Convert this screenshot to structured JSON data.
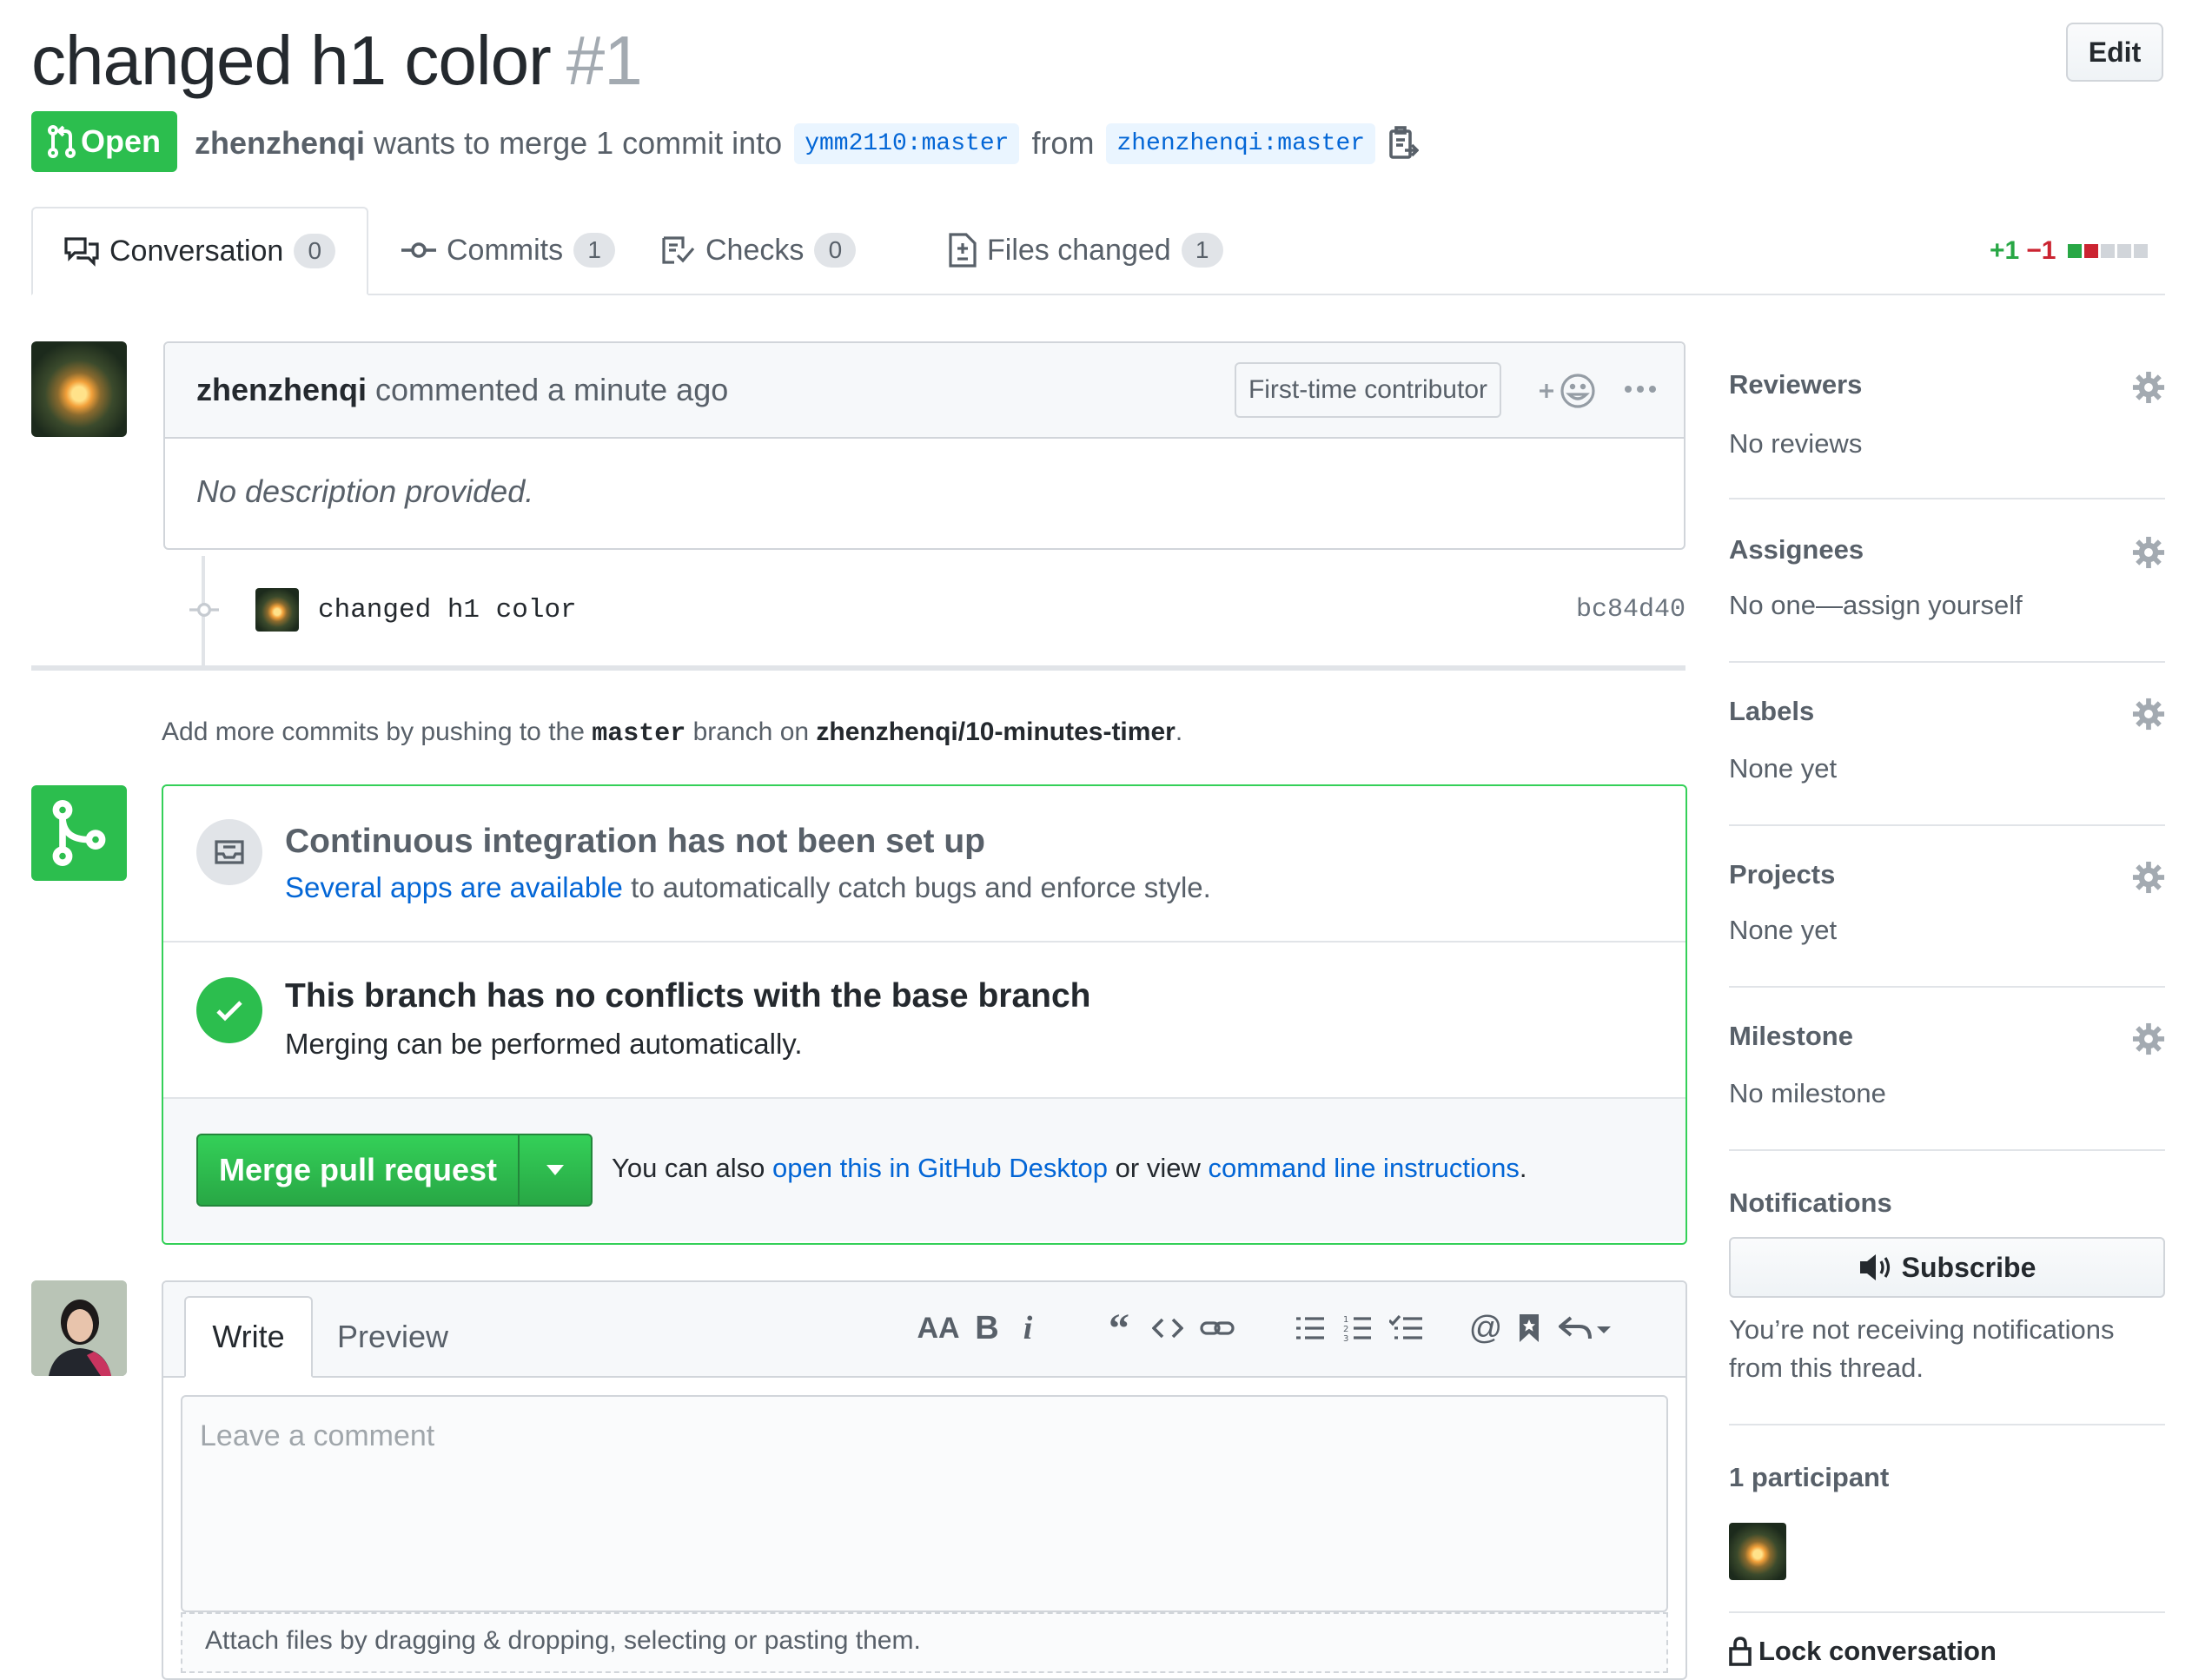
{
  "header": {
    "title": "changed h1 color",
    "number": "#1",
    "edit_label": "Edit",
    "state": "Open",
    "author": "zhenzhenqi",
    "merge_text": "wants to merge 1 commit into",
    "base_branch": "ymm2110:master",
    "from_text": "from",
    "head_branch": "zhenzhenqi:master"
  },
  "tabs": [
    {
      "label": "Conversation",
      "count": "0",
      "icon": "comment-discussion-icon"
    },
    {
      "label": "Commits",
      "count": "1",
      "icon": "git-commit-icon"
    },
    {
      "label": "Checks",
      "count": "0",
      "icon": "checklist-icon"
    },
    {
      "label": "Files changed",
      "count": "1",
      "icon": "file-diff-icon"
    }
  ],
  "diffstat": {
    "additions": "+1",
    "deletions": "−1",
    "colors": {
      "add": "#28a745",
      "del": "#cb2431",
      "neutral": "#d1d5da"
    }
  },
  "comment": {
    "author": "zhenzhenqi",
    "action": "commented a minute ago",
    "badge": "First-time contributor",
    "body": "No description provided."
  },
  "commit": {
    "message": "changed h1 color",
    "sha": "bc84d40"
  },
  "add_more": {
    "prefix": "Add more commits by pushing to the",
    "branch": "master",
    "middle": "branch on",
    "repo": "zhenzhenqi/10-minutes-timer",
    "suffix": "."
  },
  "merge": {
    "ci_title": "Continuous integration has not been set up",
    "ci_link": "Several apps are available",
    "ci_rest": "to automatically catch bugs and enforce style.",
    "conflict_title": "This branch has no conflicts with the base branch",
    "conflict_desc": "Merging can be performed automatically.",
    "button": "Merge pull request",
    "alt_prefix": "You can also",
    "alt_link1": "open this in GitHub Desktop",
    "alt_mid": "or view",
    "alt_link2": "command line instructions",
    "alt_suffix": "."
  },
  "new_comment": {
    "write_tab": "Write",
    "preview_tab": "Preview",
    "placeholder": "Leave a comment",
    "attach": "Attach files by dragging & dropping, selecting or pasting them.",
    "toolbar_icons": [
      "text-size-icon",
      "bold-icon",
      "italic-icon",
      "quote-icon",
      "code-icon",
      "link-icon",
      "unordered-list-icon",
      "ordered-list-icon",
      "task-list-icon",
      "mention-icon",
      "bookmark-icon",
      "reply-icon"
    ]
  },
  "sidebar": {
    "reviewers": {
      "title": "Reviewers",
      "value": "No reviews"
    },
    "assignees": {
      "title": "Assignees",
      "value": "No one—assign yourself"
    },
    "labels": {
      "title": "Labels",
      "value": "None yet"
    },
    "projects": {
      "title": "Projects",
      "value": "None yet"
    },
    "milestone": {
      "title": "Milestone",
      "value": "No milestone"
    },
    "notifications": {
      "title": "Notifications",
      "button": "Subscribe",
      "desc1": "You’re not receiving notifications",
      "desc2": "from this thread."
    },
    "participants": {
      "title": "1 participant"
    },
    "lock": "Lock conversation"
  },
  "colors": {
    "green": "#2cbe4e",
    "link": "#0366d6",
    "muted": "#586069"
  }
}
